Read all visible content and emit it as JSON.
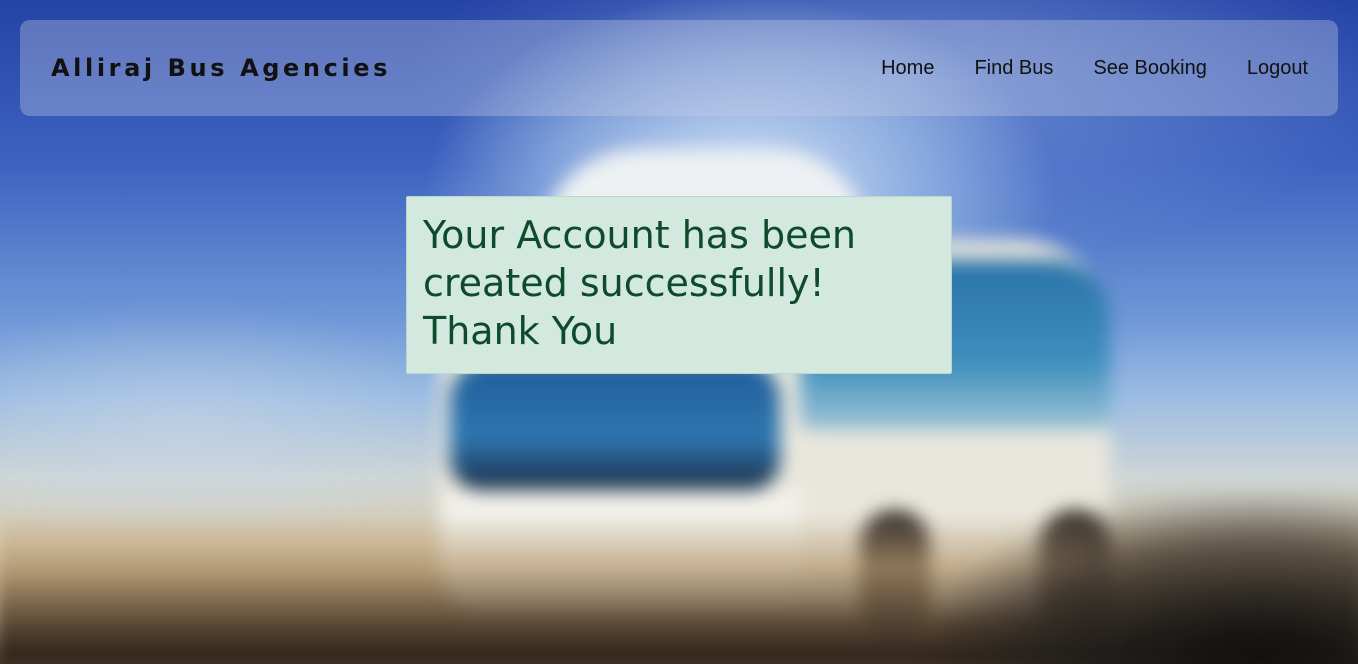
{
  "navbar": {
    "brand": "Alliraj Bus Agencies",
    "links": [
      {
        "label": "Home"
      },
      {
        "label": "Find Bus"
      },
      {
        "label": "See Booking"
      },
      {
        "label": "Logout"
      }
    ]
  },
  "alert": {
    "message": "Your Account has been created successfully! Thank You",
    "colors": {
      "background": "#d3e8df",
      "text": "#0e4a2c"
    }
  },
  "background": {
    "image": "blurred-bus-photo"
  }
}
